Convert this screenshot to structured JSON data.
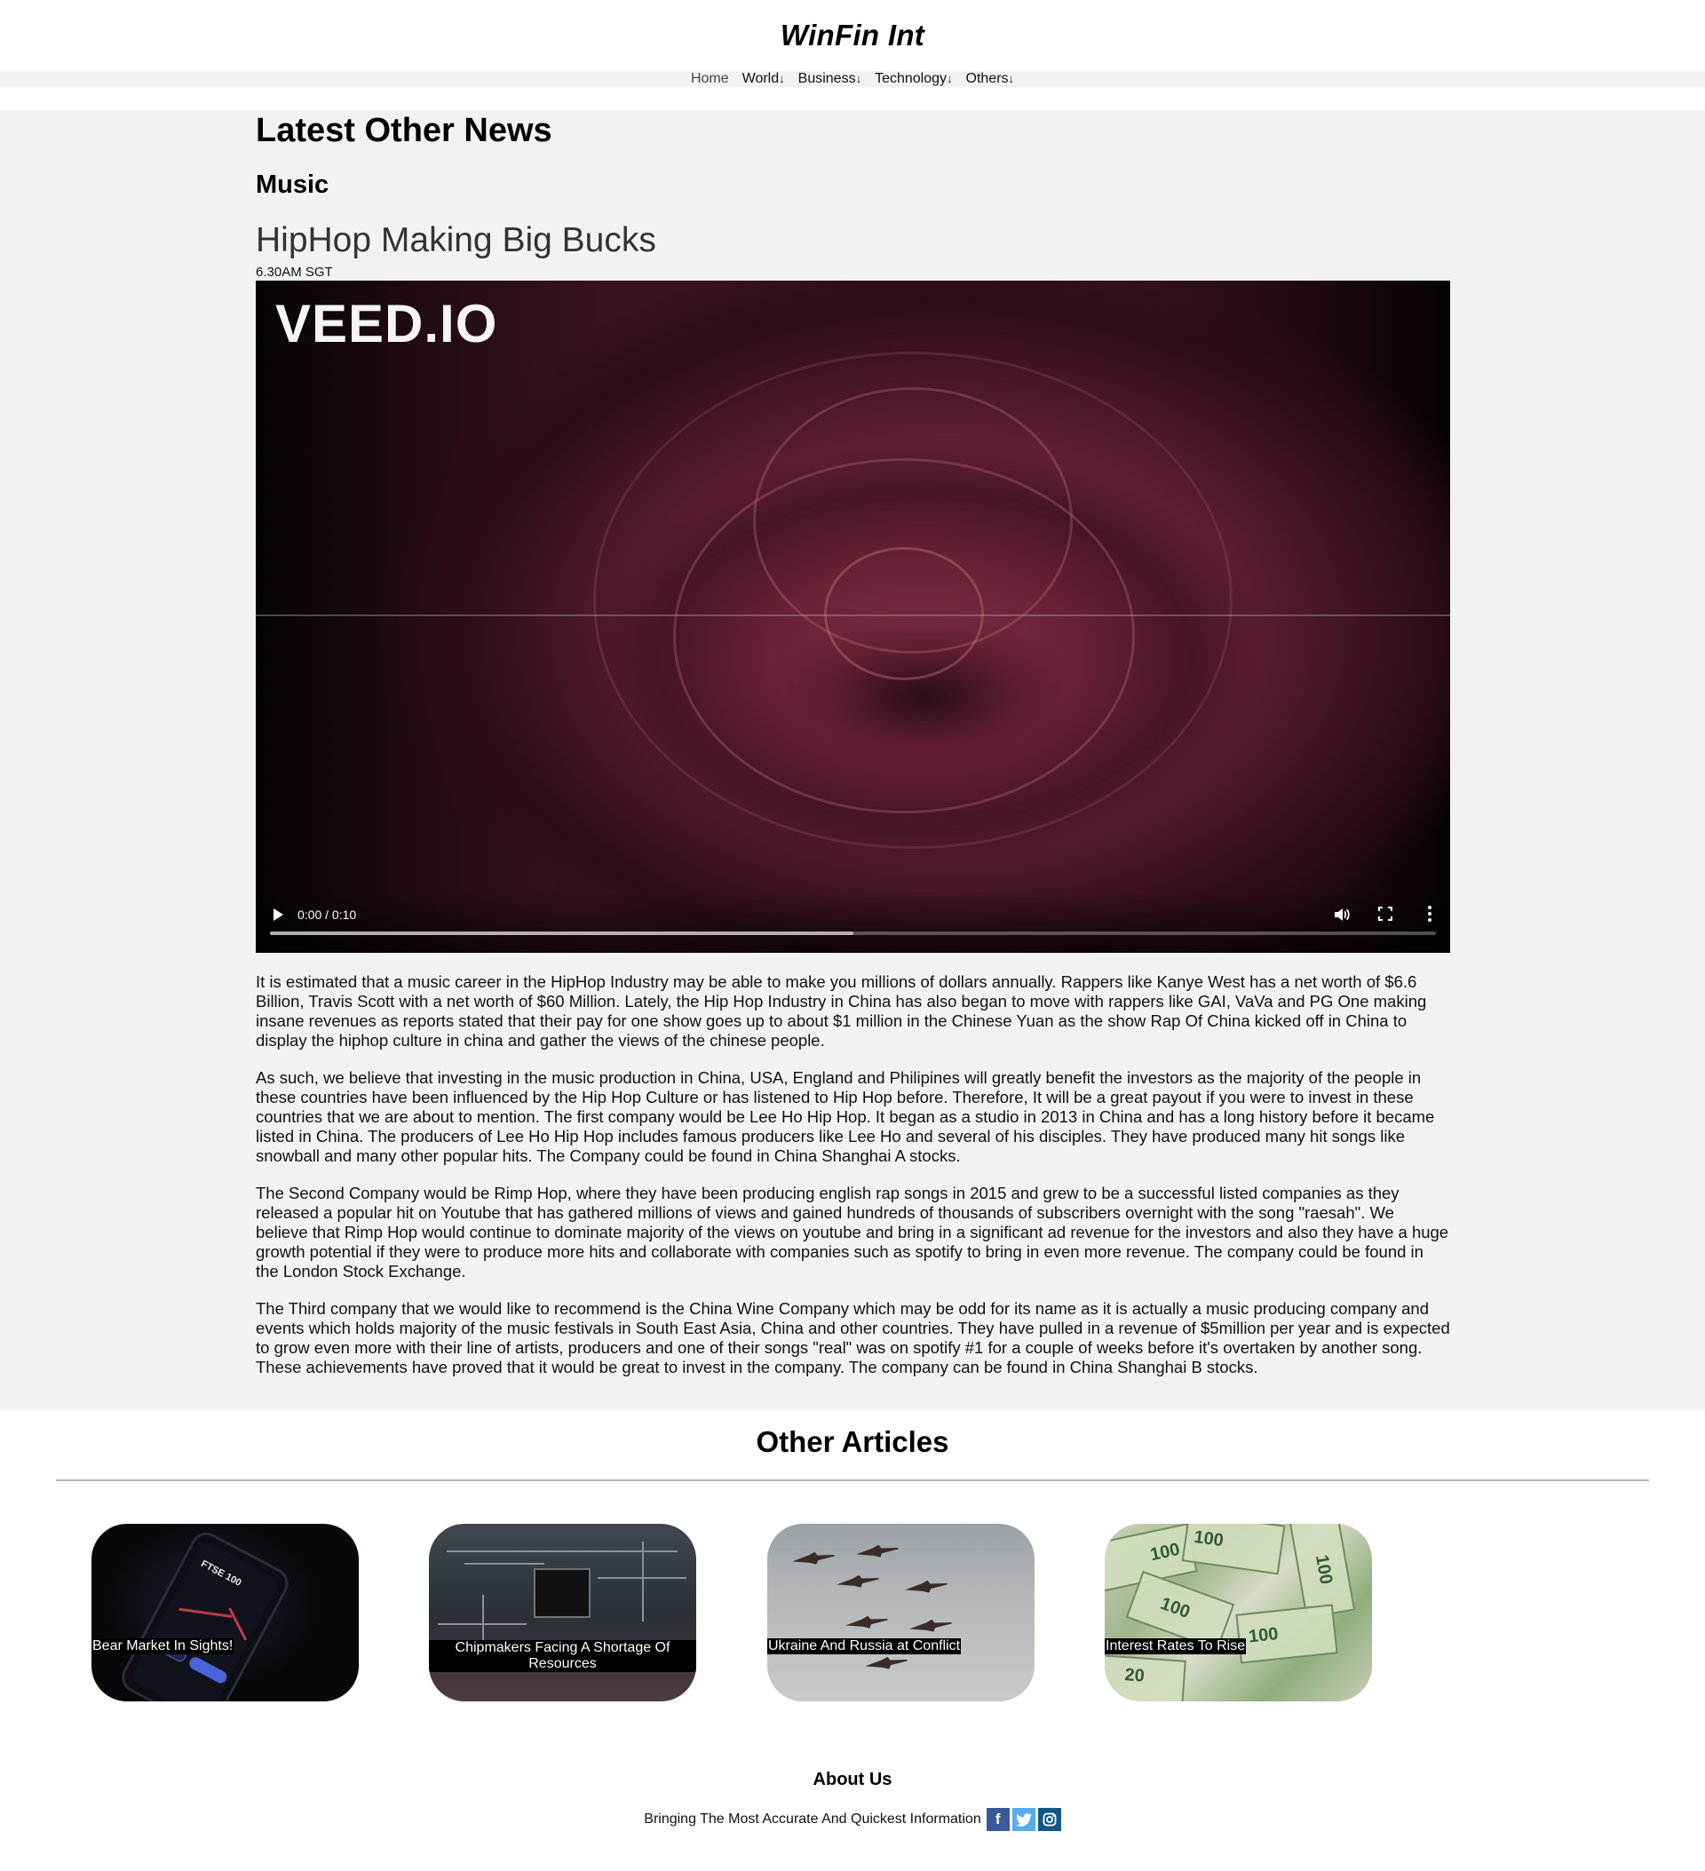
{
  "site": {
    "title": "WinFin Int"
  },
  "nav": {
    "items": [
      {
        "label": "Home",
        "arrow": ""
      },
      {
        "label": "World",
        "arrow": "↓"
      },
      {
        "label": "Business",
        "arrow": "↓"
      },
      {
        "label": "Technology",
        "arrow": "↓"
      },
      {
        "label": "Others",
        "arrow": "↓"
      }
    ]
  },
  "main": {
    "section_heading": "Latest Other News",
    "category": "Music",
    "article": {
      "title": "HipHop Making Big Bucks",
      "time": "6.30AM SGT",
      "video": {
        "watermark": "VEED.IO",
        "time_display": "0:00 / 0:10",
        "buffered_fraction": 0.5
      },
      "paragraphs": [
        "It is estimated that a music career in the HipHop Industry may be able to make you millions of dollars annually. Rappers like Kanye West has a net worth of $6.6 Billion, Travis Scott with a net worth of $60 Million. Lately, the Hip Hop Industry in China has also began to move with rappers like GAI, VaVa and PG One making insane revenues as reports stated that their pay for one show goes up to about $1 million in the Chinese Yuan as the show Rap Of China kicked off in China to display the hiphop culture in china and gather the views of the chinese people.",
        "As such, we believe that investing in the music production in China, USA, England and Philipines will greatly benefit the investors as the majority of the people in these countries have been influenced by the Hip Hop Culture or has listened to Hip Hop before. Therefore, It will be a great payout if you were to invest in these countries that we are about to mention. The first company would be Lee Ho Hip Hop. It began as a studio in 2013 in China and has a long history before it became listed in China. The producers of Lee Ho Hip Hop includes famous producers like Lee Ho and several of his disciples. They have produced many hit songs like snowball and many other popular hits. The Company could be found in China Shanghai A stocks.",
        "The Second Company would be Rimp Hop, where they have been producing english rap songs in 2015 and grew to be a successful listed companies as they released a popular hit on Youtube that has gathered millions of views and gained hundreds of thousands of subscribers overnight with the song \"raesah\". We believe that Rimp Hop would continue to dominate majority of the views on youtube and bring in a significant ad revenue for the investors and also they have a huge growth potential if they were to produce more hits and collaborate with companies such as spotify to bring in even more revenue. The company could be found in the London Stock Exchange.",
        "The Third company that we would like to recommend is the China Wine Company which may be odd for its name as it is actually a music producing company and events which holds majority of the music festivals in South East Asia, China and other countries. They have pulled in a revenue of $5million per year and is expected to grow even more with their line of artists, producers and one of their songs \"real\" was on spotify #1 for a couple of weeks before it's overtaken by another song. These achievements have proved that it would be great to invest in the company. The company can be found in China Shanghai B stocks."
      ]
    }
  },
  "other_articles": {
    "heading": "Other Articles",
    "items": [
      {
        "caption": "Bear Market In Sights!",
        "image": "smartphone-stock-chart"
      },
      {
        "caption": "Chipmakers Facing A Shortage Of Resources",
        "image": "circuit-board-chip"
      },
      {
        "caption": "Ukraine And Russia at Conflict",
        "image": "fighter-jets-formation"
      },
      {
        "caption": "Interest Rates To Rise",
        "image": "dollar-euro-banknotes"
      }
    ],
    "phone_screen_text": "FTSE 100"
  },
  "footer": {
    "about_heading": "About Us",
    "tagline": "Bringing The Most Accurate And Quickest Information",
    "social": [
      {
        "name": "facebook-icon",
        "glyph": "f",
        "color": "#3b5998"
      },
      {
        "name": "twitter-icon",
        "glyph": "t",
        "color": "#55acee"
      },
      {
        "name": "instagram-icon",
        "glyph": "◎",
        "color": "#125688"
      }
    ]
  }
}
